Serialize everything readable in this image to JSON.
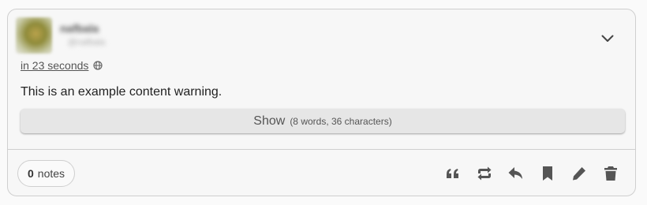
{
  "post": {
    "author_name": "nafbala",
    "author_handle": "@nafbala",
    "timestamp": "in 23 seconds",
    "content_warning": "This is an example content warning.",
    "show_label": "Show",
    "show_count": "(8 words, 36 characters)",
    "notes_count": "0",
    "notes_label": "notes"
  },
  "icons": {
    "visibility": "globe-icon",
    "collapse": "chevron-down-icon",
    "actions": [
      "quote-icon",
      "renote-icon",
      "reply-icon",
      "bookmark-icon",
      "edit-icon",
      "delete-icon"
    ]
  },
  "colors": {
    "icon": "#555555",
    "border": "#cfcfcf",
    "button_bg": "#e6e6e6"
  }
}
